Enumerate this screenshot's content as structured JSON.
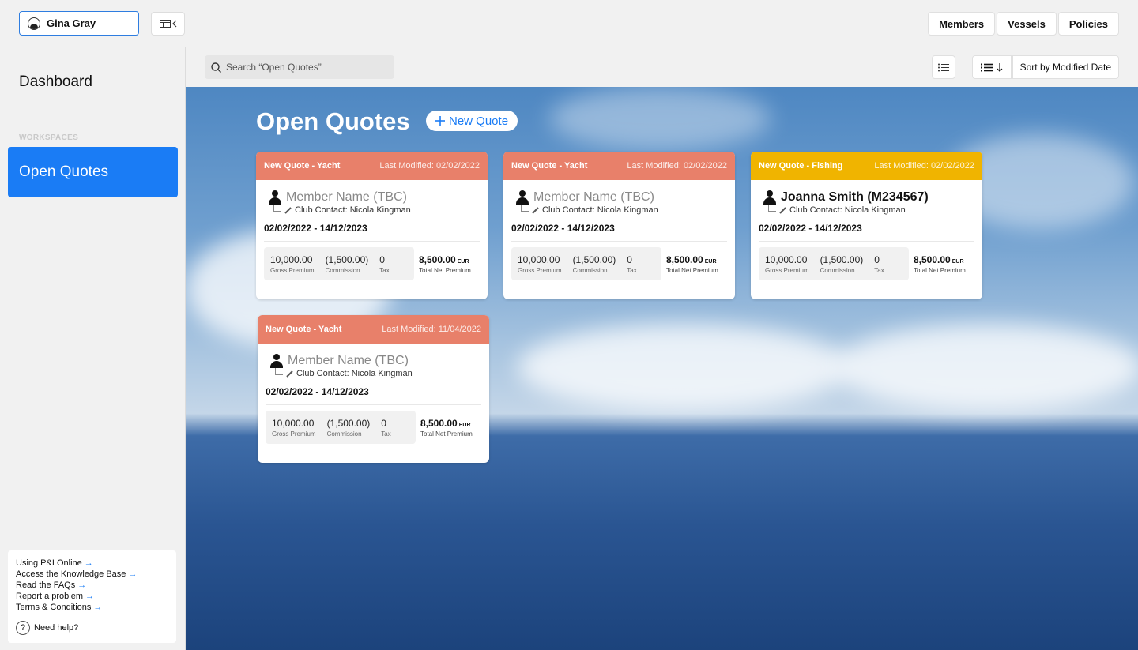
{
  "header": {
    "user_name": "Gina Gray",
    "nav": [
      "Members",
      "Vessels",
      "Policies"
    ]
  },
  "sidebar": {
    "title": "Dashboard",
    "section_label": "WORKSPACES",
    "active_item": "Open Quotes",
    "help_links": [
      "Using P&I Online",
      "Access the Knowledge Base",
      "Read the FAQs",
      "Report a problem",
      "Terms & Conditions"
    ],
    "need_help": "Need help?"
  },
  "toolbar": {
    "search_placeholder": "Search “Open Quotes”",
    "sort_label": "Sort by Modified Date"
  },
  "main": {
    "title": "Open Quotes",
    "new_quote_label": "New Quote",
    "labels": {
      "gross": "Gross Premium",
      "commission": "Commission",
      "tax": "Tax",
      "total": "Total Net Premium"
    },
    "cards": [
      {
        "type": "New Quote - Yacht",
        "modified": "Last Modified: 02/02/2022",
        "member": "Member Name (TBC)",
        "contact": "Club Contact: Nicola Kingman",
        "dates": "02/02/2022 - 14/12/2023",
        "gross": "10,000.00",
        "commission": "(1,500.00)",
        "tax": "0",
        "total": "8,500.00",
        "currency": "EUR",
        "color": "#e8806a"
      },
      {
        "type": "New Quote - Yacht",
        "modified": "Last Modified: 02/02/2022",
        "member": "Member Name (TBC)",
        "contact": "Club Contact: Nicola Kingman",
        "dates": "02/02/2022 - 14/12/2023",
        "gross": "10,000.00",
        "commission": "(1,500.00)",
        "tax": "0",
        "total": "8,500.00",
        "currency": "EUR",
        "color": "#e8806a"
      },
      {
        "type": "New Quote - Fishing",
        "modified": "Last Modified: 02/02/2022",
        "member": "Joanna Smith (M234567)",
        "contact": "Club Contact: Nicola Kingman",
        "dates": "02/02/2022 - 14/12/2023",
        "gross": "10,000.00",
        "commission": "(1,500.00)",
        "tax": "0",
        "total": "8,500.00",
        "currency": "EUR",
        "color": "#f0b400"
      },
      {
        "type": "New Quote - Yacht",
        "modified": "Last Modified: 11/04/2022",
        "member": "Member Name (TBC)",
        "contact": "Club Contact: Nicola Kingman",
        "dates": "02/02/2022 - 14/12/2023",
        "gross": "10,000.00",
        "commission": "(1,500.00)",
        "tax": "0",
        "total": "8,500.00",
        "currency": "EUR",
        "color": "#e8806a"
      }
    ]
  }
}
